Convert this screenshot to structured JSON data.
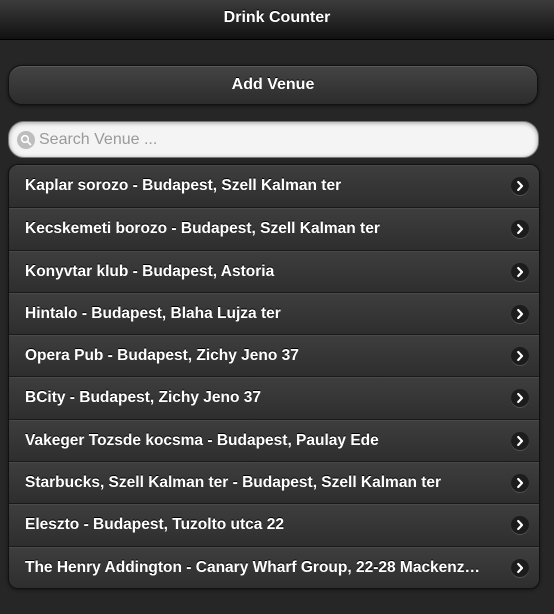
{
  "header": {
    "title": "Drink Counter"
  },
  "add_button": {
    "label": "Add Venue"
  },
  "search": {
    "placeholder": "Search Venue ...",
    "value": "",
    "icon": "search-icon"
  },
  "venues": [
    {
      "label": "Kaplar sorozo - Budapest, Szell Kalman ter"
    },
    {
      "label": "Kecskemeti borozo - Budapest, Szell Kalman ter"
    },
    {
      "label": "Konyvtar klub - Budapest, Astoria"
    },
    {
      "label": "Hintalo - Budapest, Blaha Lujza ter"
    },
    {
      "label": "Opera Pub - Budapest, Zichy Jeno 37"
    },
    {
      "label": "BCity - Budapest, Zichy Jeno 37"
    },
    {
      "label": "Vakeger Tozsde kocsma - Budapest, Paulay Ede"
    },
    {
      "label": "Starbucks, Szell Kalman ter - Budapest, Szell Kalman ter"
    },
    {
      "label": "Eleszto - Budapest, Tuzolto utca 22"
    },
    {
      "label": "The Henry Addington - Canary Wharf Group, 22-28 Mackenz…"
    }
  ],
  "colors": {
    "background": "#262626",
    "text": "#ffffff",
    "search_bg": "#f4f4f4",
    "placeholder": "#9a9a9a"
  },
  "icons": {
    "list_item_arrow": "chevron-right-icon"
  }
}
